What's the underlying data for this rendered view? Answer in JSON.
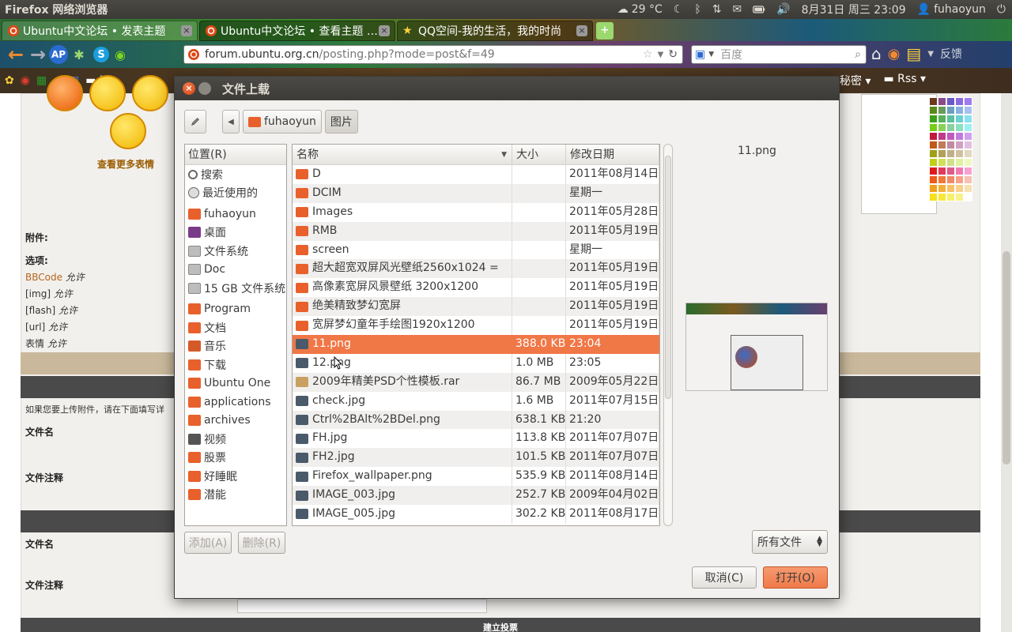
{
  "topPanel": {
    "appTitle": "Firefox 网络浏览器",
    "weather": "29 °C",
    "datetime": "8月31日 周三 23:09",
    "user": "fuhaoyun"
  },
  "tabs": [
    {
      "title": "Ubuntu中文论坛 • 发表主题",
      "close": "×"
    },
    {
      "title": "Ubuntu中文论坛 • 查看主题 …",
      "close": "×"
    },
    {
      "title": "QQ空间-我的生活，我的时尚",
      "close": "×"
    }
  ],
  "newTab": "+",
  "nav": {
    "urlHost": "forum.ubuntu.org.cn",
    "urlPath": "/posting.php?mode=post&f=49",
    "searchPlaceholder": "百度",
    "feedback": "反馈"
  },
  "bookmarks": {
    "left": "L",
    "secret": "秘密",
    "rss": "Rss"
  },
  "webpage": {
    "moreEmoji": "查看更多表情",
    "attachLabel": "附件:",
    "optionsLabel": "选项:",
    "options": [
      {
        "name": "BBCode",
        "value": "允许"
      },
      {
        "name": "[img]",
        "value": "允许"
      },
      {
        "name": "[flash]",
        "value": "允许"
      },
      {
        "name": "[url]",
        "value": "允许"
      },
      {
        "name": "表情",
        "value": "允许"
      }
    ],
    "uploadHint": "如果您要上传附件，请在下面填写详",
    "fileNameLabel": "文件名",
    "fileNoteLabel": "文件注释",
    "fileNameLabel2": "文件名",
    "fileNoteLabel2": "文件注释",
    "bottomBar": "建立投票"
  },
  "dialog": {
    "title": "文件上载",
    "closeGlyph": "×",
    "path": [
      "fuhaoyun",
      "图片"
    ],
    "placesHeader": "位置(R)",
    "places": [
      {
        "label": "搜索",
        "icon": "search-icon"
      },
      {
        "label": "最近使用的",
        "icon": "clock-icon"
      },
      {
        "label": "fuhaoyun",
        "icon": "home-folder-icon"
      },
      {
        "label": "桌面",
        "icon": "desktop-icon"
      },
      {
        "label": "文件系统",
        "icon": "drive-icon"
      },
      {
        "label": "Doc",
        "icon": "drive-icon"
      },
      {
        "label": "15 GB 文件系统",
        "icon": "drive-icon"
      },
      {
        "label": "Program",
        "icon": "folder-icon"
      },
      {
        "label": "文档",
        "icon": "documents-folder-icon"
      },
      {
        "label": "音乐",
        "icon": "music-folder-icon"
      },
      {
        "label": "下载",
        "icon": "download-folder-icon"
      },
      {
        "label": "Ubuntu One",
        "icon": "folder-icon"
      },
      {
        "label": "applications",
        "icon": "folder-icon"
      },
      {
        "label": "archives",
        "icon": "folder-icon"
      },
      {
        "label": "视频",
        "icon": "video-folder-icon"
      },
      {
        "label": "股票",
        "icon": "folder-icon"
      },
      {
        "label": "好睡眠",
        "icon": "folder-icon"
      },
      {
        "label": "潜能",
        "icon": "folder-icon"
      }
    ],
    "columns": {
      "name": "名称",
      "size": "大小",
      "date": "修改日期"
    },
    "files": [
      {
        "name": "D",
        "size": "",
        "date": "2011年08月14日",
        "type": "folder"
      },
      {
        "name": "DCIM",
        "size": "",
        "date": "星期一",
        "type": "folder"
      },
      {
        "name": "Images",
        "size": "",
        "date": "2011年05月28日",
        "type": "folder"
      },
      {
        "name": "RMB",
        "size": "",
        "date": "2011年05月19日",
        "type": "folder"
      },
      {
        "name": "screen",
        "size": "",
        "date": "星期一",
        "type": "folder"
      },
      {
        "name": "超大超宽双屏风光壁纸2560x1024 =",
        "size": "",
        "date": "2011年05月19日",
        "type": "folder"
      },
      {
        "name": "高像素宽屏风景壁纸 3200x1200",
        "size": "",
        "date": "2011年05月19日",
        "type": "folder"
      },
      {
        "name": "绝美精致梦幻宽屏",
        "size": "",
        "date": "2011年05月19日",
        "type": "folder"
      },
      {
        "name": "宽屏梦幻童年手绘图1920x1200",
        "size": "",
        "date": "2011年05月19日",
        "type": "folder"
      },
      {
        "name": "11.png",
        "size": "388.0 KB",
        "date": "23:04",
        "type": "image",
        "selected": true
      },
      {
        "name": "12.png",
        "size": "1.0 MB",
        "date": "23:05",
        "type": "image"
      },
      {
        "name": "2009年精美PSD个性模板.rar",
        "size": "86.7 MB",
        "date": "2009年05月22日",
        "type": "archive"
      },
      {
        "name": "check.jpg",
        "size": "1.6 MB",
        "date": "2011年07月15日",
        "type": "image"
      },
      {
        "name": "Ctrl%2BAlt%2BDel.png",
        "size": "638.1 KB",
        "date": "21:20",
        "type": "image"
      },
      {
        "name": "FH.jpg",
        "size": "113.8 KB",
        "date": "2011年07月07日",
        "type": "image"
      },
      {
        "name": "FH2.jpg",
        "size": "101.5 KB",
        "date": "2011年07月07日",
        "type": "image"
      },
      {
        "name": "Firefox_wallpaper.png",
        "size": "535.9 KB",
        "date": "2011年08月14日",
        "type": "image"
      },
      {
        "name": "IMAGE_003.jpg",
        "size": "252.7 KB",
        "date": "2009年04月02日",
        "type": "image"
      },
      {
        "name": "IMAGE_005.jpg",
        "size": "302.2 KB",
        "date": "2011年08月17日",
        "type": "image"
      }
    ],
    "previewName": "11.png",
    "addButton": "添加(A)",
    "removeButton": "删除(R)",
    "filterValue": "所有文件",
    "cancelButton": "取消(C)",
    "openButton": "打开(O)",
    "colors": {
      "selection": "#f07746",
      "folder": "#e8602c",
      "accent": "#dd4814"
    }
  }
}
